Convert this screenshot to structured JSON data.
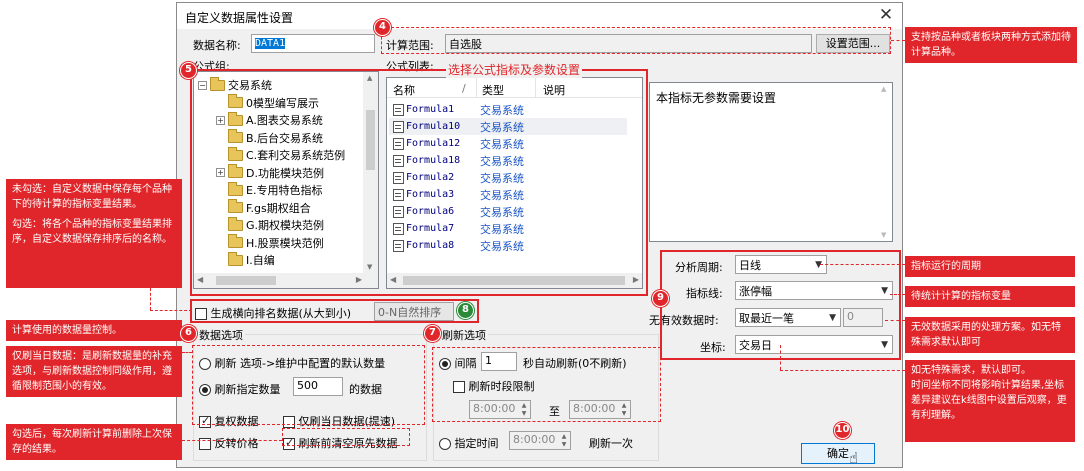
{
  "dialog": {
    "title": "自定义数据属性设置",
    "data_name_label": "数据名称:",
    "data_name_value": "DATA1",
    "calc_range_label": "计算范围:",
    "calc_range_value": "自选股",
    "set_range_button": "设置范围...",
    "formula_group_label": "公式组:",
    "formula_list_label": "公式列表:",
    "no_param_text": "本指标无参数需要设置",
    "ok_button": "确定"
  },
  "tree": {
    "items": [
      {
        "label": "交易系统",
        "level": 0,
        "expander": "−"
      },
      {
        "label": "0模型编写展示",
        "level": 1,
        "expander": ""
      },
      {
        "label": "A.图表交易系统",
        "level": 1,
        "expander": "+"
      },
      {
        "label": "B.后台交易系统",
        "level": 1,
        "expander": ""
      },
      {
        "label": "C.套利交易系统范例",
        "level": 1,
        "expander": ""
      },
      {
        "label": "D.功能模块范例",
        "level": 1,
        "expander": "+"
      },
      {
        "label": "E.专用特色指标",
        "level": 1,
        "expander": ""
      },
      {
        "label": "F.gs期权组合",
        "level": 1,
        "expander": ""
      },
      {
        "label": "G.期权模块范例",
        "level": 1,
        "expander": ""
      },
      {
        "label": "H.股票模块范例",
        "level": 1,
        "expander": ""
      },
      {
        "label": "I.自编",
        "level": 1,
        "expander": ""
      }
    ]
  },
  "formula_list": {
    "columns": [
      "名称",
      "/",
      "类型",
      "说明"
    ],
    "rows": [
      {
        "name": "Formula1",
        "type": "交易系统"
      },
      {
        "name": "Formula10",
        "type": "交易系统"
      },
      {
        "name": "Formula12",
        "type": "交易系统"
      },
      {
        "name": "Formula18",
        "type": "交易系统"
      },
      {
        "name": "Formula2",
        "type": "交易系统"
      },
      {
        "name": "Formula3",
        "type": "交易系统"
      },
      {
        "name": "Formula6",
        "type": "交易系统"
      },
      {
        "name": "Formula7",
        "type": "交易系统"
      },
      {
        "name": "Formula8",
        "type": "交易系统"
      }
    ]
  },
  "params": {
    "period_label": "分析周期:",
    "period_value": "日线",
    "indicator_label": "指标线:",
    "indicator_value": "涨停幅",
    "invalid_label": "无有效数据时:",
    "invalid_value": "取最近一笔",
    "invalid_number": "0",
    "coord_label": "坐标:",
    "coord_value": "交易日"
  },
  "ranking": {
    "checkbox_label": "生成横向排名数据(从大到小)",
    "sort_value": "0-N自然排序"
  },
  "data_options": {
    "title": "数据选项",
    "radio1": "刷新 选项->维护中配置的默认数量",
    "radio2": "刷新指定数量",
    "count_value": "500",
    "count_suffix": "的数据",
    "chk_fq": "复权数据",
    "chk_today": "仅刷当日数据(提速)",
    "chk_reverse": "反转价格",
    "chk_clear": "刷新前清空原先数据"
  },
  "refresh_options": {
    "title": "刷新选项",
    "interval_label": "间隔",
    "interval_value": "1",
    "interval_suffix": "秒自动刷新(0不刷新)",
    "chk_time": "刷新时段限制",
    "time_from": "8:00:00",
    "to_label": "至",
    "time_to": "8:00:00",
    "specified_label": "指定时间",
    "specified_time": "8:00:00",
    "specified_suffix": "刷新一次"
  },
  "annotations": {
    "overlay_formula_title": "选择公式指标及参数设置",
    "note_range": "支持按品种或者板块两种方式添加待计算品种。",
    "note_unchecked": "未勾选：自定义数据中保存每个品种下的待计算的指标变量结果。",
    "note_checked": "勾选：将各个品种的指标变量结果排序，自定义数据保存排序后的名称。",
    "note_datactrl": "计算使用的数据量控制。",
    "note_today": "仅刷当日数据：是刷新数据量的补充选项，与刷新数据控制同级作用，遵循限制范围小的有效。",
    "note_clear": "勾选后，每次刷新计算前删除上次保存的结果。",
    "note_period": "指标运行的周期",
    "note_indicator": "待统计计算的指标变量",
    "note_invalid": "无效数据采用的处理方案。如无特殊需求默认即可",
    "note_coord": "如无特殊需求，默认即可。\n时间坐标不同将影响计算结果,坐标差异建议在k线图中设置后观察，更有利理解。",
    "badges": [
      "4",
      "5",
      "6",
      "7",
      "8",
      "9",
      "10"
    ]
  },
  "colors": {
    "accent_red": "#e0262a",
    "badge_green": "#2a8a3a"
  }
}
